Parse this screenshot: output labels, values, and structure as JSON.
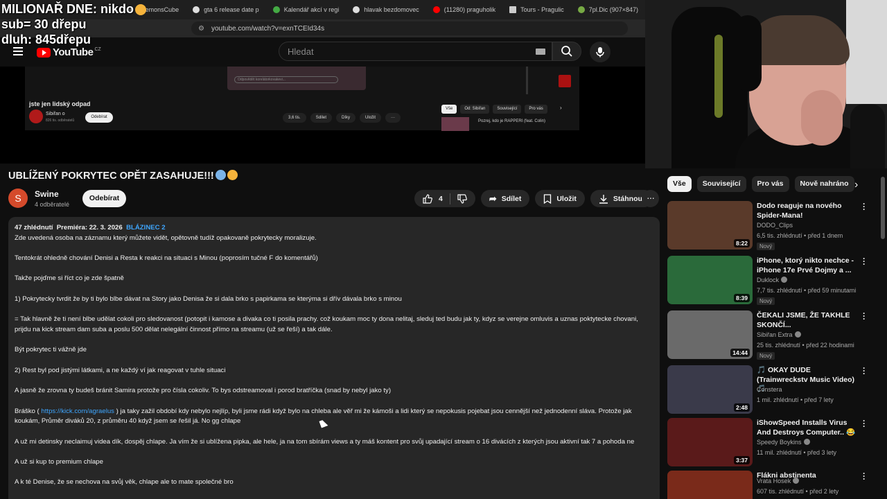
{
  "browser": {
    "tabs": [
      "kDemonsCube",
      "gta 6 release date p",
      "Kalendář akcí v regi",
      "hlavak bezdomovec",
      "(11280) praguholik",
      "Tours - Pragulic",
      "7pl.Dic (907×847)"
    ],
    "url": "youtube.com/watch?v=exnTCEId34s"
  },
  "overlay": {
    "line1": "MILIONAŘ DNE: nikdo",
    "line2": "sub= 30 dřepu",
    "line3": "dluh: 845dřepu"
  },
  "header": {
    "logo": "YouTube",
    "region": "CZ",
    "search_placeholder": "Hledat"
  },
  "player": {
    "comment_placeholder": "Odpovědět korelátorkovakevi...",
    "title": "jste jen lidský odpad",
    "channel": "Sibiřan o",
    "subs": "826 tis. odběratelů",
    "subscribe": "Odebírat",
    "buttons": [
      "3,6 tis.",
      "Sdílet",
      "Díky",
      "Uložit",
      "···"
    ],
    "chips": [
      "Vše",
      "Od: Sibiřan",
      "Související",
      "Pro vás"
    ],
    "related": "Pozrej, kdo je RAPPERI (feat. Colin)"
  },
  "video": {
    "title": "UBLÍŽENÝ POKRYTEC OPĚT ZASAHUJE!!!",
    "channel": "Swine",
    "channel_initial": "S",
    "subs": "4 odběratelé",
    "subscribe": "Odebírat",
    "likes": "4",
    "share": "Sdílet",
    "save": "Uložit",
    "download": "Stáhnout"
  },
  "description": {
    "views": "47 zhlédnutí",
    "premiere": "Premiéra: 22. 3. 2026",
    "hashtag": "BLÁZINEC 2",
    "p1": "Zde uvedená osoba na záznamu který můžete vidět, opětovně tudíž opakovaně pokrytecky moralizuje.",
    "p2": "Tentokrát ohledně chování Denisi a Resta k reakci na situaci s Minou (poprosím tučné F do komentářů)",
    "p3": "Takže pojďme si říct co je zde špatně",
    "p4": "1) Pokrytecky tvrdit že by ti bylo blbe dávat na Story jako Denisa že si dala brko s papirkama se kterýma si dřív dávala brko s minou",
    "p5": "= Tak hlavně že ti není blbe udělat cokoli pro sledovanost (potopit i kamose a divaka co ti posila prachy. což koukam moc ty dona nelitaj, sleduj ted budu jak ty, kdyz se verejne omluvis a uznas poktytecke chovani, prijdu na kick stream dam suba a poslu 500 dělat nelegální činnost přímo na streamu (už se řeší) a tak dále.",
    "p6": "Být pokrytec ti vážně jde",
    "p7": "2) Rest byl pod jistými látkami, a ne každý ví jak reagovat v tuhle situaci",
    "p8": "A jasně že zrovna ty budeš bránit Samira protože pro čísla cokoliv. To bys odstreamoval i porod bratříčka (snad by nebyl jako ty)",
    "p9a": "Bráško (",
    "p9link": "https://kick.com/agraelus",
    "p9b": ") ja taky zažil období kdy nebylo nejlíp, byli jsme rádi když bylo na chleba ale věř mi že kámoši a lidi který se nepokusis pojebat jsou cennější než jednodenní sláva. Protože jak  koukám, Průměr diváků 20, z průměru 40 když jsem se řešil já. No gg chlape",
    "p10": "A už mi detinsky neclaimuj videa dík, dospěj chlape. Ja vím že si ublížena pipka, ale hele, ja na tom sbírám views a ty máš kontent pro svůj upadající stream o 16 divácích z kterých jsou aktivní tak 7 a pohoda ne",
    "p11": "A už si kup to premium chlape",
    "p12": "A k té Denise, že se nechova na svůj věk, chlape ale to mate společné bro"
  },
  "sidebar": {
    "chips": [
      "Vše",
      "Související",
      "Pro vás",
      "Nově nahráno"
    ],
    "items": [
      {
        "title": "Dodo reaguje na nového Spider-Mana!",
        "channel": "DODO_Clips",
        "meta": "6,5 tis. zhlédnutí • před 1 dnem",
        "badge": "Nový",
        "duration": "8:22",
        "color": "#5a3a2a"
      },
      {
        "title": "iPhone, ktorý nikto nechce - iPhone 17e Prvé Dojmy a ...",
        "channel": "Duklock",
        "meta": "7,7 tis. zhlédnutí • před 59 minutami",
        "badge": "Nový",
        "duration": "8:39",
        "color": "#2a6a3a"
      },
      {
        "title": "ČEKALI JSME, ŽE TAKHLE SKONČÍ...",
        "channel": "Sibiřan Extra",
        "meta": "25 tis. zhlédnutí • před 22 hodinami",
        "badge": "Nový",
        "duration": "14:44",
        "color": "#6a6a6a"
      },
      {
        "title": "🎵 OKAY DUDE (Trainwreckstv Music Video) 🎵",
        "channel": "Constera",
        "meta": "1 mil. zhlédnutí • před 7 lety",
        "badge": "",
        "duration": "2:48",
        "color": "#3a3a4a"
      },
      {
        "title": "iShowSpeed Installs Virus And Destroys Computer.. 😂",
        "channel": "Speedy Boykins",
        "meta": "11 mil. zhlédnutí • před 3 lety",
        "badge": "",
        "duration": "3:37",
        "color": "#5a1a1a"
      },
      {
        "title": "Flákni abstinenta",
        "channel": "Vrata Hosek",
        "meta": "607 tis. zhlédnutí • před 2 lety",
        "badge": "",
        "duration": "",
        "color": "#7a2a1a"
      }
    ]
  },
  "colors": {
    "accent_red": "#ff0000",
    "link_blue": "#3ea6ff"
  }
}
